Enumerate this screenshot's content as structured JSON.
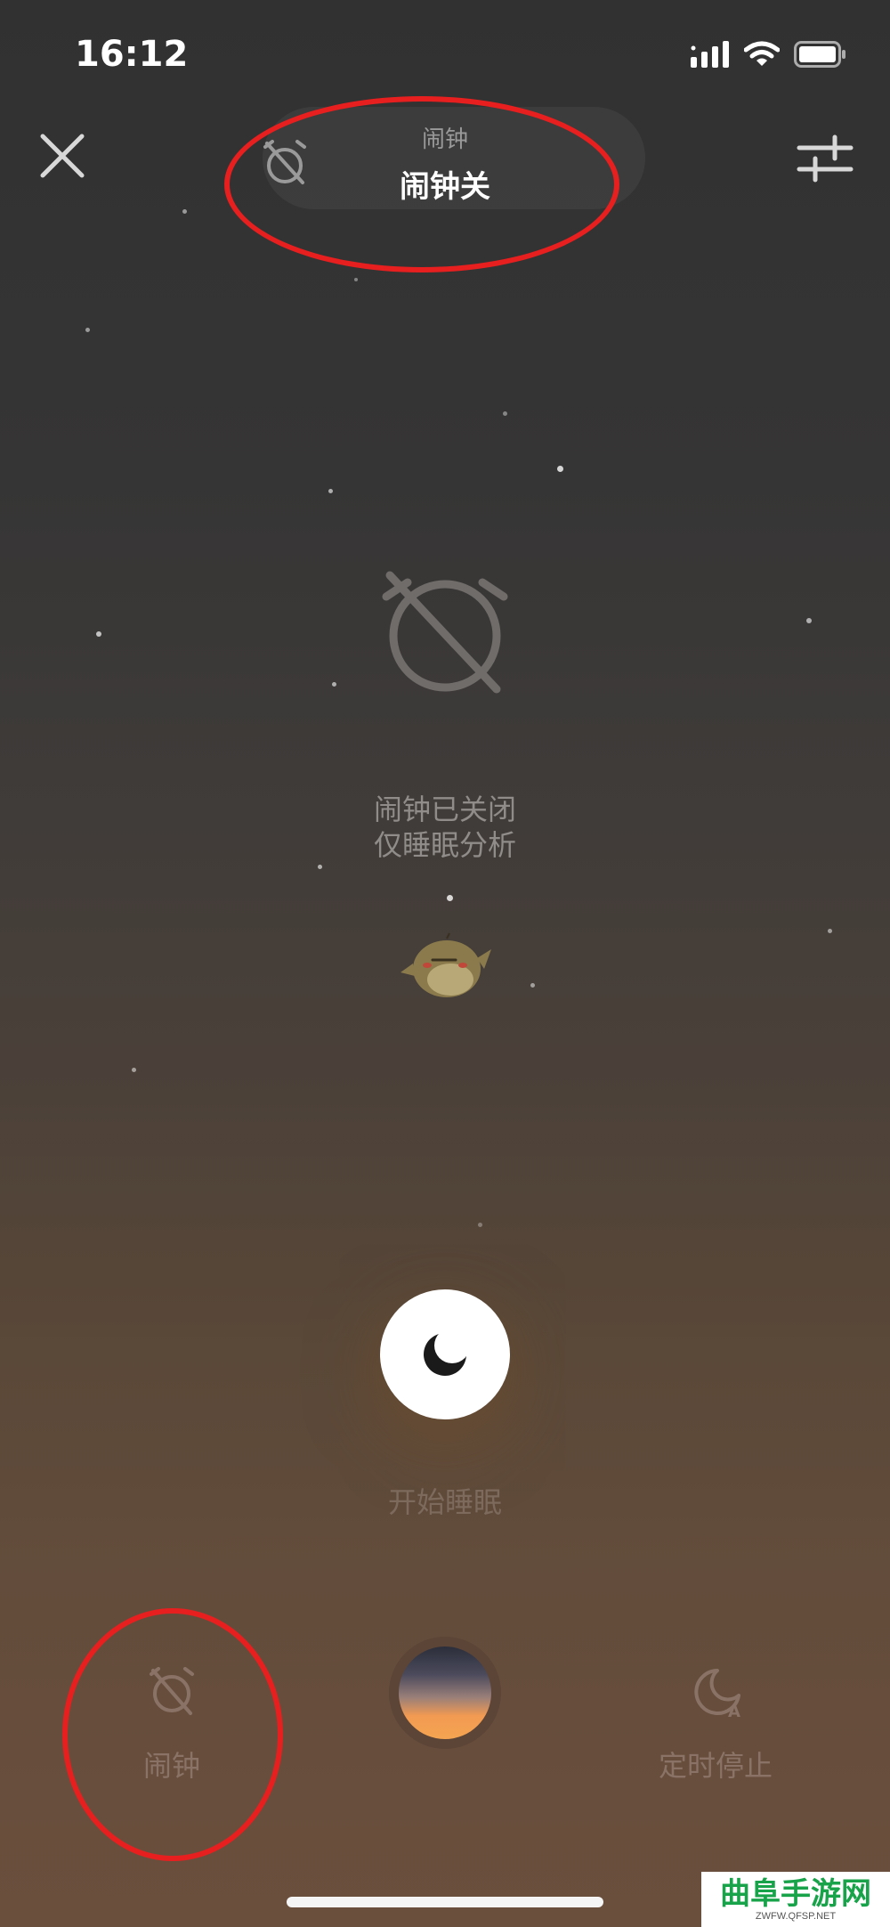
{
  "status_bar": {
    "time": "16:12"
  },
  "top_bar": {
    "alarm_title": "闹钟",
    "alarm_value": "闹钟关"
  },
  "main": {
    "alarm_status_line1": "闹钟已关闭",
    "alarm_status_line2": "仅睡眠分析",
    "start_sleep_label": "开始睡眠"
  },
  "toolbar": {
    "alarm_label": "闹钟",
    "timer_label": "定时停止"
  },
  "watermark": {
    "main": "曲阜手游网",
    "sub": "ZWFW.QFSP.NET"
  },
  "colors": {
    "annotation_red": "#e81f1f",
    "scene_orange": "#f29a52"
  }
}
